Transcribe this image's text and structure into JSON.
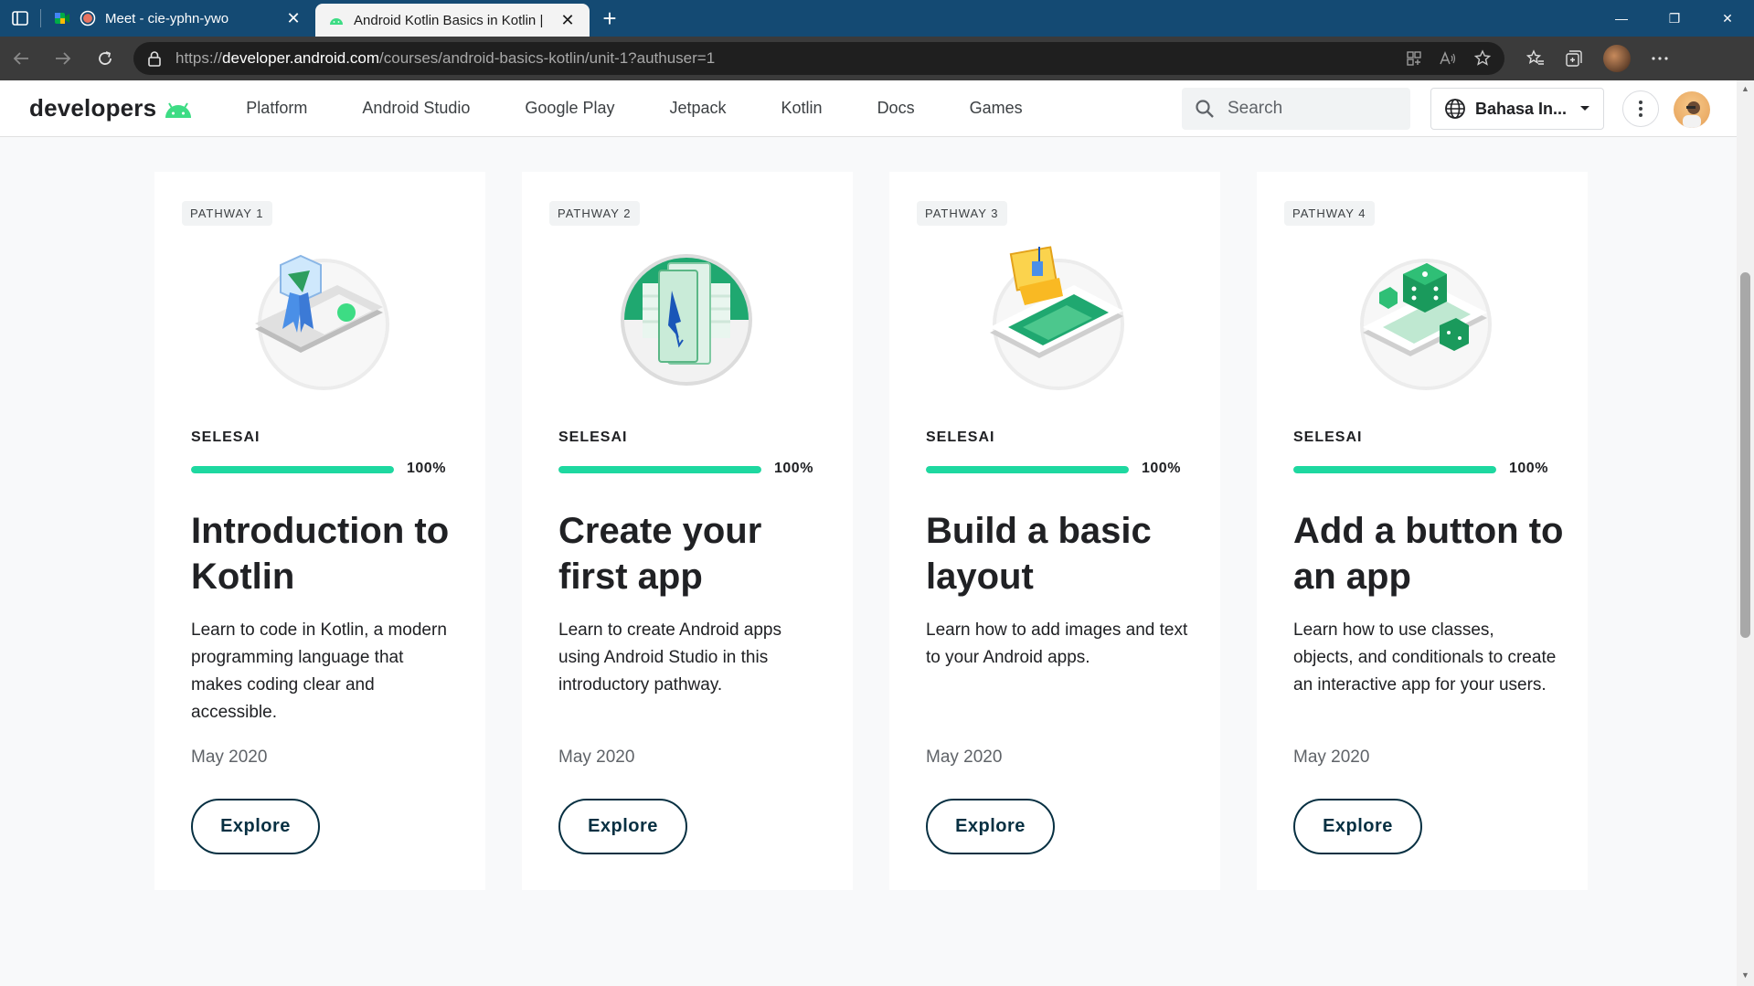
{
  "browser": {
    "tabs": [
      {
        "title": "Meet - cie-yphn-ywo",
        "active": false
      },
      {
        "title": "Android Kotlin Basics in Kotlin |",
        "active": true
      }
    ],
    "url_scheme": "https://",
    "url_host": "developer.android.com",
    "url_path": "/courses/android-basics-kotlin/unit-1?authuser=1"
  },
  "site": {
    "logo_text": "developers",
    "nav": [
      "Platform",
      "Android Studio",
      "Google Play",
      "Jetpack",
      "Kotlin",
      "Docs",
      "Games"
    ],
    "search_placeholder": "Search",
    "language": "Bahasa In..."
  },
  "cards": [
    {
      "badge": "PATHWAY 1",
      "status": "SELESAI",
      "progress_percent": 100,
      "progress_label": "100%",
      "title": "Introduction to Kotlin",
      "description": "Learn to code in Kotlin, a modern programming language that makes coding clear and accessible.",
      "date": "May 2020",
      "button": "Explore"
    },
    {
      "badge": "PATHWAY 2",
      "status": "SELESAI",
      "progress_percent": 100,
      "progress_label": "100%",
      "title": "Create your first app",
      "description": "Learn to create Android apps using Android Studio in this introductory pathway.",
      "date": "May 2020",
      "button": "Explore"
    },
    {
      "badge": "PATHWAY 3",
      "status": "SELESAI",
      "progress_percent": 100,
      "progress_label": "100%",
      "title": "Build a basic layout",
      "description": "Learn how to add images and text to your Android apps.",
      "date": "May 2020",
      "button": "Explore"
    },
    {
      "badge": "PATHWAY 4",
      "status": "SELESAI",
      "progress_percent": 100,
      "progress_label": "100%",
      "title": "Add a button to an app",
      "description": "Learn how to use classes, objects, and conditionals to create an interactive app for your users.",
      "date": "May 2020",
      "button": "Explore"
    }
  ],
  "colors": {
    "tabstrip": "#144a73",
    "accent_progress": "#1ed8a0",
    "button_border": "#073042",
    "android_green": "#3ddc84"
  }
}
